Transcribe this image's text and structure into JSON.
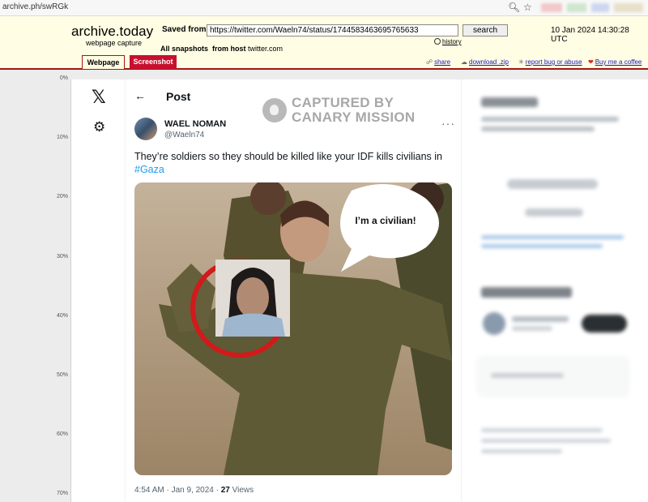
{
  "browser": {
    "address": "archive.ph/swRGk"
  },
  "archive": {
    "brand": "archive.today",
    "brand_sub": "webpage capture",
    "saved_from_label": "Saved from",
    "url_value": "https://twitter.com/Waeln74/status/1744583463695765633",
    "search_label": "search",
    "history_label": "history",
    "all_snapshots_label": "All snapshots",
    "from_host_label": "from host",
    "host": "twitter.com",
    "datetime": "10 Jan 2024 14:30:28 UTC",
    "tabs": [
      {
        "label": "Webpage",
        "active": true
      },
      {
        "label": "Screenshot",
        "active": false
      }
    ],
    "tools": {
      "share": "share",
      "download": "download .zip",
      "report": "report bug or abuse",
      "coffee": "Buy me a coffee"
    }
  },
  "ruler": [
    "0%",
    "10%",
    "20%",
    "30%",
    "40%",
    "50%",
    "60%",
    "70%"
  ],
  "tweet": {
    "header_title": "Post",
    "author_name": "WAEL NOMAN",
    "author_handle": "@Waeln74",
    "text_main": "They’re soldiers so they should be killed like your IDF kills civilians in",
    "hashtag": "#Gaza",
    "speech_bubble": "I’m a civilian!",
    "time": "4:54 AM · Jan 9, 2024 ·",
    "views_count": "27",
    "views_label": "Views"
  },
  "watermark": {
    "line1": "CAPTURED BY",
    "line2": "CANARY MISSION"
  },
  "colors": {
    "archive_bg": "#fffde4",
    "archive_accent": "#a31515",
    "twitter_blue": "#1d9bf0",
    "highlight_circle": "#d11a1a"
  }
}
